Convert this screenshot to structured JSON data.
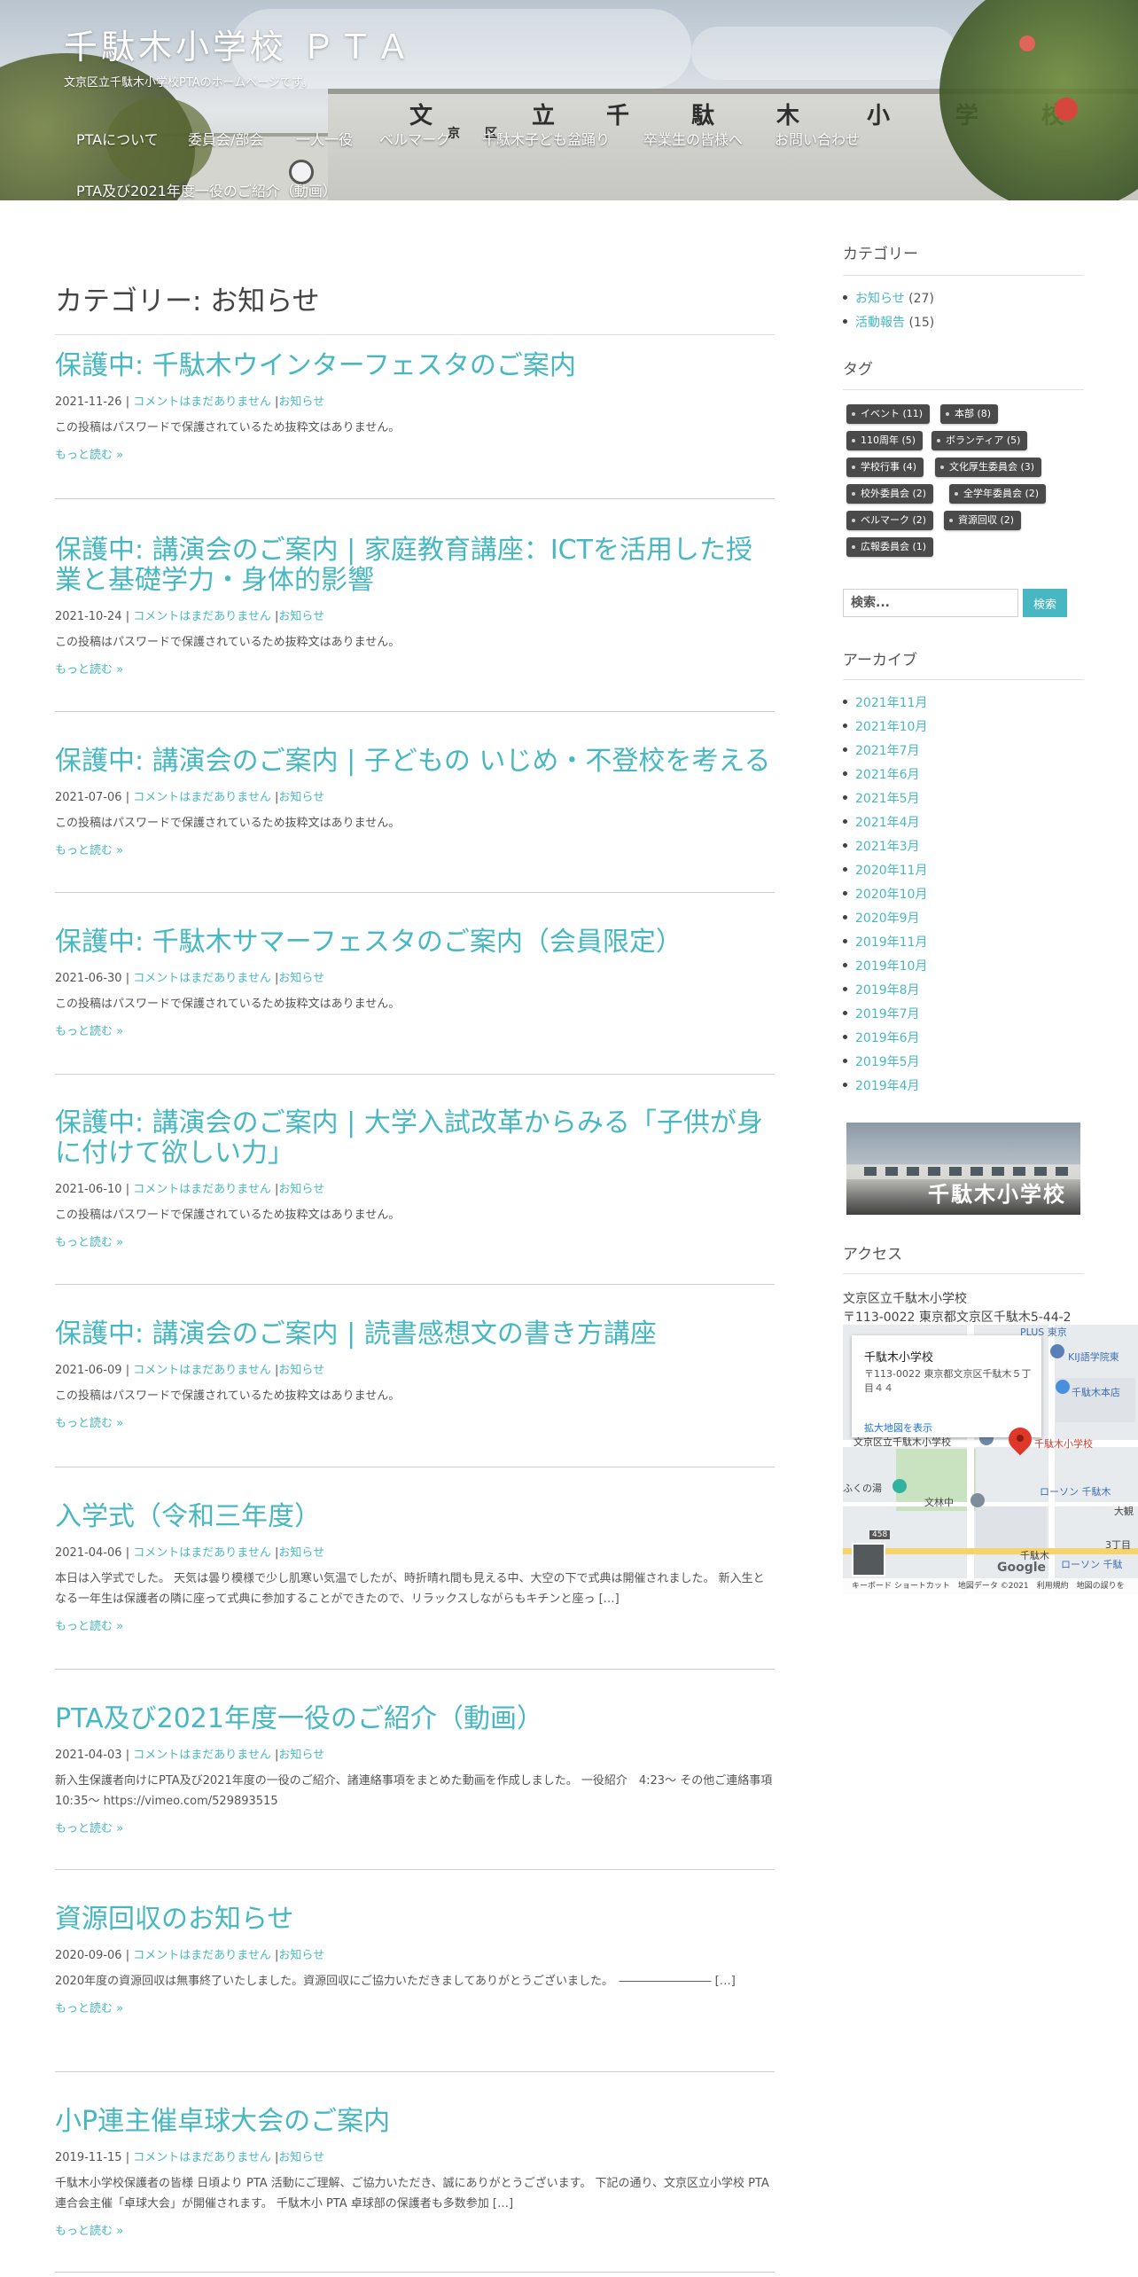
{
  "site": {
    "title": "千駄木小学校 ＰＴＡ",
    "description": "文京区立千駄木小学校PTAのホームページです。"
  },
  "nav": {
    "items": [
      "PTAについて",
      "委員会/部会",
      "一人一役",
      "ベルマーク",
      "千駄木子ども盆踊り",
      "卒業生の皆様へ",
      "お問い合わせ",
      "PTA及び2021年度一役のご紹介（動画）"
    ]
  },
  "header_sign": [
    "文",
    "京",
    "区",
    "立",
    "千",
    "駄",
    "木",
    "小",
    "学",
    "校"
  ],
  "page_title": "カテゴリー: お知らせ",
  "posts": [
    {
      "title": "保護中: 千駄木ウインターフェスタのご案内",
      "date": "2021-11-26",
      "sep1": " | ",
      "comments": "コメントはまだありません",
      "sep2": " |",
      "category": "お知らせ",
      "excerpt": "この投稿はパスワードで保護されているため抜粋文はありません。",
      "more": "もっと読む »"
    },
    {
      "title": "保護中: 講演会のご案内 | 家庭教育講座：ICTを活用した授業と基礎学力・身体的影響",
      "date": "2021-10-24",
      "sep1": " | ",
      "comments": "コメントはまだありません",
      "sep2": " |",
      "category": "お知らせ",
      "excerpt": "この投稿はパスワードで保護されているため抜粋文はありません。",
      "more": "もっと読む »"
    },
    {
      "title": "保護中: 講演会のご案内 | 子どもの いじめ・不登校を考える",
      "date": "2021-07-06",
      "sep1": " | ",
      "comments": "コメントはまだありません",
      "sep2": " |",
      "category": "お知らせ",
      "excerpt": "この投稿はパスワードで保護されているため抜粋文はありません。",
      "more": "もっと読む »"
    },
    {
      "title": "保護中: 千駄木サマーフェスタのご案内（会員限定）",
      "date": "2021-06-30",
      "sep1": " | ",
      "comments": "コメントはまだありません",
      "sep2": " |",
      "category": "お知らせ",
      "excerpt": "この投稿はパスワードで保護されているため抜粋文はありません。",
      "more": "もっと読む »"
    },
    {
      "title": "保護中: 講演会のご案内 | 大学入試改革からみる「子供が身に付けて欲しい力」",
      "date": "2021-06-10",
      "sep1": " | ",
      "comments": "コメントはまだありません",
      "sep2": " |",
      "category": "お知らせ",
      "excerpt": "この投稿はパスワードで保護されているため抜粋文はありません。",
      "more": "もっと読む »"
    },
    {
      "title": "保護中: 講演会のご案内 | 読書感想文の書き方講座",
      "date": "2021-06-09",
      "sep1": " | ",
      "comments": "コメントはまだありません",
      "sep2": " |",
      "category": "お知らせ",
      "excerpt": "この投稿はパスワードで保護されているため抜粋文はありません。",
      "more": "もっと読む »"
    },
    {
      "title": "入学式（令和三年度）",
      "date": "2021-04-06",
      "sep1": " | ",
      "comments": "コメントはまだありません",
      "sep2": " |",
      "category": "お知らせ",
      "excerpt": "本日は入学式でした。 天気は曇り模様で少し肌寒い気温でしたが、時折晴れ間も見える中、大空の下で式典は開催されました。 新入生となる一年生は保護者の隣に座って式典に参加することができたので、リラックスしながらもキチンと座っ […]",
      "more": "もっと読む »"
    },
    {
      "title": "PTA及び2021年度一役のご紹介（動画）",
      "date": "2021-04-03",
      "sep1": " | ",
      "comments": "コメントはまだありません",
      "sep2": " |",
      "category": "お知らせ",
      "excerpt": "新入生保護者向けにPTA及び2021年度の一役のご紹介、諸連絡事項をまとめた動画を作成しました。 一役紹介　4:23〜 その他ご連絡事項　10:35〜 https://vimeo.com/529893515",
      "more": "もっと読む »"
    },
    {
      "title": "資源回収のお知らせ",
      "date": "2020-09-06",
      "sep1": " | ",
      "comments": "コメントはまだありません",
      "sep2": " |",
      "category": "お知らせ",
      "excerpt": "2020年度の資源回収は無事終了いたしました。資源回収にご協力いただきましてありがとうございました。　―――――――― […]",
      "more": "もっと読む »"
    },
    {
      "title": "小P連主催卓球大会のご案内",
      "date": "2019-11-15",
      "sep1": " | ",
      "comments": "コメントはまだありません",
      "sep2": " |",
      "category": "お知らせ",
      "excerpt": "千駄木小学校保護者の皆様 日頃より PTA 活動にご理解、ご協力いただき、誠にありがとうございます。 下記の通り、文京区立小学校 PTA 連合会主催「卓球大会」が開催されます。 千駄木小 PTA 卓球部の保護者も多数参加 […]",
      "more": "もっと読む »"
    }
  ],
  "sidebar": {
    "categories": {
      "title": "カテゴリー",
      "items": [
        {
          "label": "お知らせ",
          "count": " (27)"
        },
        {
          "label": "活動報告",
          "count": " (15)"
        }
      ]
    },
    "tags": {
      "title": "タグ",
      "items": [
        "イベント (11)",
        "本部 (8)",
        "110周年 (5)",
        "ボランティア (5)",
        "学校行事 (4)",
        "文化厚生委員会 (3)",
        "校外委員会 (2)",
        "全学年委員会 (2)",
        "ベルマーク (2)",
        "資源回収 (2)",
        "広報委員会 (1)"
      ]
    },
    "search": {
      "placeholder": "検索...",
      "button": "検索"
    },
    "archives": {
      "title": "アーカイブ",
      "items": [
        "2021年11月",
        "2021年10月",
        "2021年7月",
        "2021年6月",
        "2021年5月",
        "2021年4月",
        "2021年3月",
        "2020年11月",
        "2020年10月",
        "2020年9月",
        "2019年11月",
        "2019年10月",
        "2019年8月",
        "2019年7月",
        "2019年6月",
        "2019年5月",
        "2019年4月"
      ]
    },
    "school_photo_caption": "千駄木小学校",
    "access": {
      "title": "アクセス",
      "line1": "文京区立千駄木小学校",
      "line2": "〒113-0022 東京都文京区千駄木5-44-2"
    },
    "map": {
      "info_title": "千駄木小学校",
      "info_address": "〒113-0022 東京都文京区千駄木５丁目４４",
      "info_link": "拡大地図を表示",
      "marker_label": "千駄木小学校",
      "labels": {
        "kij": "KIJ語学院東",
        "senbon": "千駄木本店",
        "school_left": "文京区立千駄木小学校",
        "lawson1": "ローソン 千駄木",
        "lawson2": "ローソン 千駄",
        "bunrin": "文林中",
        "fukuno": "ふくの湯",
        "sendagi": "千駄木",
        "chome": "3丁目",
        "plus": "PLUS 東京",
        "route": "458",
        "ohkubo": "大観"
      },
      "google": "Google",
      "footer": "キーボード ショートカット　地図データ ©2021　利用規約　地図の誤りを"
    }
  }
}
